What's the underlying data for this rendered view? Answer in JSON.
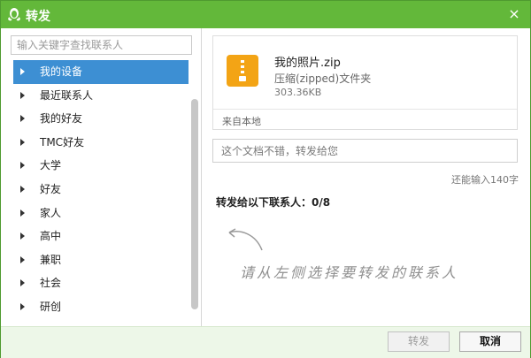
{
  "window": {
    "title": "转发",
    "close_symbol": "×"
  },
  "contacts": {
    "search_placeholder": "输入关键字查找联系人",
    "items": [
      {
        "label": "我的设备",
        "selected": true
      },
      {
        "label": "最近联系人"
      },
      {
        "label": "我的好友"
      },
      {
        "label": "TMC好友"
      },
      {
        "label": "大学"
      },
      {
        "label": "好友"
      },
      {
        "label": "家人"
      },
      {
        "label": "高中"
      },
      {
        "label": "兼职"
      },
      {
        "label": "社会"
      },
      {
        "label": "研创"
      }
    ]
  },
  "file": {
    "name": "我的照片.zip",
    "type": "压缩(zipped)文件夹",
    "size": "303.36KB",
    "source": "来自本地",
    "icon": "zip-folder-icon",
    "icon_color": "#f3a415"
  },
  "message": {
    "placeholder": "这个文档不错，转发给您"
  },
  "remaining_text": "还能输入140字",
  "forward_to_label": "转发给以下联系人：0/8",
  "hint_text": "请从左侧选择要转发的联系人",
  "buttons": {
    "forward": "转发",
    "cancel": "取消"
  },
  "colors": {
    "title_bar": "#63b83a",
    "selected": "#3d8fd3",
    "footer": "#edf7e8"
  }
}
